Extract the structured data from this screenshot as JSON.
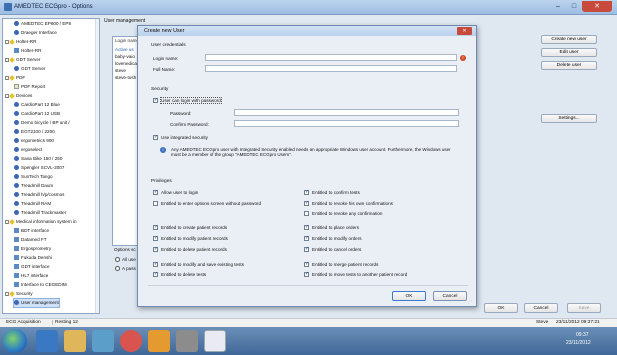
{
  "window": {
    "title": "AMEDTEC ECGpro - Options"
  },
  "tree": {
    "items": [
      {
        "label": "AMEDTEC EP800 / EP8",
        "icon": "device-icon",
        "indent": 1
      },
      {
        "label": "Draeger Interface",
        "icon": "device-icon",
        "indent": 1
      },
      {
        "label": "Holter-RR",
        "icon": "star-icon",
        "indent": 0,
        "expand": "-"
      },
      {
        "label": "Holter-RR",
        "icon": "plug-icon",
        "indent": 1
      },
      {
        "label": "GDT Server",
        "icon": "star-icon",
        "indent": 0,
        "expand": "-"
      },
      {
        "label": "GDT Server",
        "icon": "device-icon",
        "indent": 1
      },
      {
        "label": "PDF",
        "icon": "star-icon",
        "indent": 0,
        "expand": "-"
      },
      {
        "label": "PDF Report",
        "icon": "page-icon",
        "indent": 1
      },
      {
        "label": "Devices",
        "icon": "star-icon",
        "indent": 0,
        "expand": "-"
      },
      {
        "label": "CardioPart 12 Blue",
        "icon": "device-icon",
        "indent": 1
      },
      {
        "label": "CardioPart 12 USB",
        "icon": "device-icon",
        "indent": 1
      },
      {
        "label": "Demo bicycle / BP unit /",
        "icon": "device-icon",
        "indent": 1
      },
      {
        "label": "EGT2100 / 2200",
        "icon": "device-icon",
        "indent": 1
      },
      {
        "label": "ergometrics 900",
        "icon": "device-icon",
        "indent": 1
      },
      {
        "label": "ergoselect",
        "icon": "device-icon",
        "indent": 1
      },
      {
        "label": "Sana Bike 150 / 250",
        "icon": "device-icon",
        "indent": 1
      },
      {
        "label": "Spengler SCVL-2007",
        "icon": "device-icon",
        "indent": 1
      },
      {
        "label": "SunTech Tango",
        "icon": "device-icon",
        "indent": 1
      },
      {
        "label": "Treadmill Daum",
        "icon": "device-icon",
        "indent": 1
      },
      {
        "label": "Treadmill h/p/cosmos",
        "icon": "device-icon",
        "indent": 1
      },
      {
        "label": "Treadmill RAM",
        "icon": "device-icon",
        "indent": 1
      },
      {
        "label": "Treadmill Trackmaster",
        "icon": "device-icon",
        "indent": 1
      },
      {
        "label": "Medical information system in",
        "icon": "star-icon",
        "indent": 0,
        "expand": "-"
      },
      {
        "label": "BDT interface",
        "icon": "plug-icon",
        "indent": 1
      },
      {
        "label": "Datamed FT",
        "icon": "plug-icon",
        "indent": 1
      },
      {
        "label": "Ergosprometry",
        "icon": "plug-icon",
        "indent": 1
      },
      {
        "label": "Fukuda Denshi",
        "icon": "plug-icon",
        "indent": 1
      },
      {
        "label": "GDT interface",
        "icon": "plug-icon",
        "indent": 1
      },
      {
        "label": "HL7 interface",
        "icon": "plug-icon",
        "indent": 1
      },
      {
        "label": "Interface to CEGEDIM",
        "icon": "plug-icon",
        "indent": 1
      },
      {
        "label": "Security",
        "icon": "star-icon",
        "indent": 0,
        "expand": "-"
      },
      {
        "label": "User management",
        "icon": "device-icon",
        "indent": 1,
        "selected": true
      }
    ]
  },
  "user_management": {
    "label": "User management",
    "login_header": "Login name",
    "logins": [
      "Active us",
      "baby-vaio",
      "lovenedical",
      "steve",
      "steve-tosh"
    ],
    "options_label": "Options sc",
    "radio_all": "All use",
    "radio_pass": "A pass",
    "buttons": {
      "create": "Create new user",
      "edit": "Edit user",
      "delete": "Delete user",
      "settings": "Settings...",
      "ok": "OK",
      "cancel": "Cancel",
      "save": "Save"
    }
  },
  "dialog": {
    "title": "Create new User",
    "close": "✕",
    "credentials_label": "User credentials",
    "login_name_label": "Login name:",
    "full_name_label": "Full Name:",
    "security_label": "Security",
    "login_with_password": "User can login with password",
    "password_label": "Password:",
    "confirm_password_label": "Confirm Password:",
    "integrated_security": "Use integrated security",
    "info_text": "Any AMEDTEC ECGpro user with Integrated Security enabled needs an appropriate Windows user account. Furthermore, the Windows user must be a member of the group \"AMEDTEC ECGpro Users\".",
    "privileges_label": "Privileges",
    "privileges_left": [
      {
        "label": "Allow user to login",
        "checked": true
      },
      {
        "label": "Entitled to enter options screen without password",
        "checked": false
      },
      {
        "label": "Entitled to create patient records",
        "checked": true
      },
      {
        "label": "Entitled to modify patient records",
        "checked": true
      },
      {
        "label": "Entitled to delete patient records",
        "checked": true
      },
      {
        "label": "Entitled to modify and save existing tests",
        "checked": true
      },
      {
        "label": "Entitled to delete tests",
        "checked": true
      }
    ],
    "privileges_right": [
      {
        "label": "Entitled to confirm tests",
        "checked": true
      },
      {
        "label": "Entitled to revoke his own confirmations",
        "checked": true
      },
      {
        "label": "Entitled to revoke any confirmation",
        "checked": false
      },
      {
        "label": "Entitled to place orders",
        "checked": true
      },
      {
        "label": "Entitled to modify orders",
        "checked": true
      },
      {
        "label": "Entitled to cancel orders",
        "checked": true
      },
      {
        "label": "Entitled to merge patient records",
        "checked": true
      },
      {
        "label": "Entitled to move tests to another patient record",
        "checked": true
      }
    ],
    "ok": "OK",
    "cancel": "Cancel"
  },
  "statusbar": {
    "left1": "ECG Acquisition",
    "left2": "Resting 12",
    "user": "Steve",
    "datetime": "23/11/2012 09:37:21"
  },
  "taskbar": {
    "time": "09:37",
    "date": "23/11/2012"
  },
  "colors": {
    "accent": "#3b7ad1",
    "close": "#c84a3c"
  }
}
